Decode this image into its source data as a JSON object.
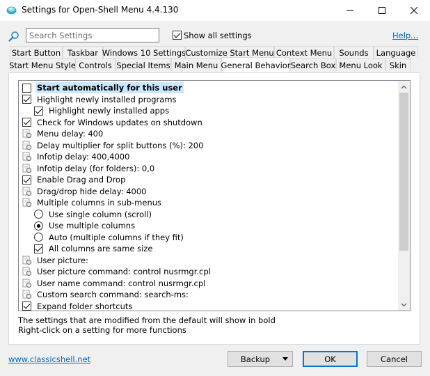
{
  "window": {
    "title": "Settings for Open-Shell Menu 4.4.130",
    "icon": "shell-app-icon",
    "controls": [
      "minimize",
      "maximize",
      "close"
    ]
  },
  "search": {
    "placeholder": "Search Settings",
    "value": "",
    "icon": "search-icon"
  },
  "show_all": {
    "label": "Show all settings",
    "checked": true
  },
  "help_label": "Help...",
  "tabs_row1": [
    {
      "label": "Start Button"
    },
    {
      "label": "Taskbar"
    },
    {
      "label": "Windows 10 Settings"
    },
    {
      "label": "Customize Start Menu"
    },
    {
      "label": "Context Menu"
    },
    {
      "label": "Sounds"
    },
    {
      "label": "Language"
    }
  ],
  "tabs_row2": [
    {
      "label": "Start Menu Style"
    },
    {
      "label": "Controls"
    },
    {
      "label": "Special Items"
    },
    {
      "label": "Main Menu"
    },
    {
      "label": "General Behavior",
      "active": true
    },
    {
      "label": "Search Box"
    },
    {
      "label": "Menu Look"
    },
    {
      "label": "Skin"
    }
  ],
  "settings": [
    {
      "type": "checkbox",
      "checked": false,
      "label": "Start automatically for this user",
      "bold": true,
      "selected": true,
      "indent": 0
    },
    {
      "type": "checkbox",
      "checked": true,
      "label": "Highlight newly installed programs",
      "indent": 0
    },
    {
      "type": "checkbox",
      "checked": true,
      "label": "Highlight newly installed apps",
      "indent": 1
    },
    {
      "type": "checkbox",
      "checked": true,
      "label": "Check for Windows updates on shutdown",
      "indent": 0
    },
    {
      "type": "gear",
      "label": "Menu delay: 400",
      "indent": 0
    },
    {
      "type": "gear",
      "label": "Delay multiplier for split buttons (%): 200",
      "indent": 0
    },
    {
      "type": "gear",
      "label": "Infotip delay: 400,4000",
      "indent": 0
    },
    {
      "type": "gear",
      "label": "Infotip delay (for folders): 0,0",
      "indent": 0
    },
    {
      "type": "checkbox",
      "checked": true,
      "label": "Enable Drag and Drop",
      "indent": 0
    },
    {
      "type": "gear",
      "label": "Drag/drop hide delay: 4000",
      "indent": 0
    },
    {
      "type": "gear",
      "label": "Multiple columns in sub-menus",
      "indent": 0
    },
    {
      "type": "radio",
      "checked": false,
      "label": "Use single column (scroll)",
      "indent": 1
    },
    {
      "type": "radio",
      "checked": true,
      "label": "Use multiple columns",
      "indent": 1
    },
    {
      "type": "radio",
      "checked": false,
      "label": "Auto (multiple columns if they fit)",
      "indent": 1
    },
    {
      "type": "checkbox",
      "checked": true,
      "label": "All columns are same size",
      "indent": 1
    },
    {
      "type": "gear",
      "label": "User picture:",
      "indent": 0
    },
    {
      "type": "gear",
      "label": "User picture command: control nusrmgr.cpl",
      "indent": 0
    },
    {
      "type": "gear",
      "label": "User name command: control nusrmgr.cpl",
      "indent": 0
    },
    {
      "type": "gear",
      "label": "Custom search command: search-ms:",
      "indent": 0
    },
    {
      "type": "checkbox",
      "checked": true,
      "label": "Expand folder shortcuts",
      "indent": 0
    }
  ],
  "info": {
    "line1": "The settings that are modified from the default will show in bold",
    "line2": "Right-click on a setting for more functions"
  },
  "footer": {
    "site_link": "www.classicshell.net",
    "backup_label": "Backup",
    "ok_label": "OK",
    "cancel_label": "Cancel"
  },
  "colors": {
    "selection": "#cce8ff",
    "link": "#0066cc",
    "default_button_border": "#0078d7"
  }
}
